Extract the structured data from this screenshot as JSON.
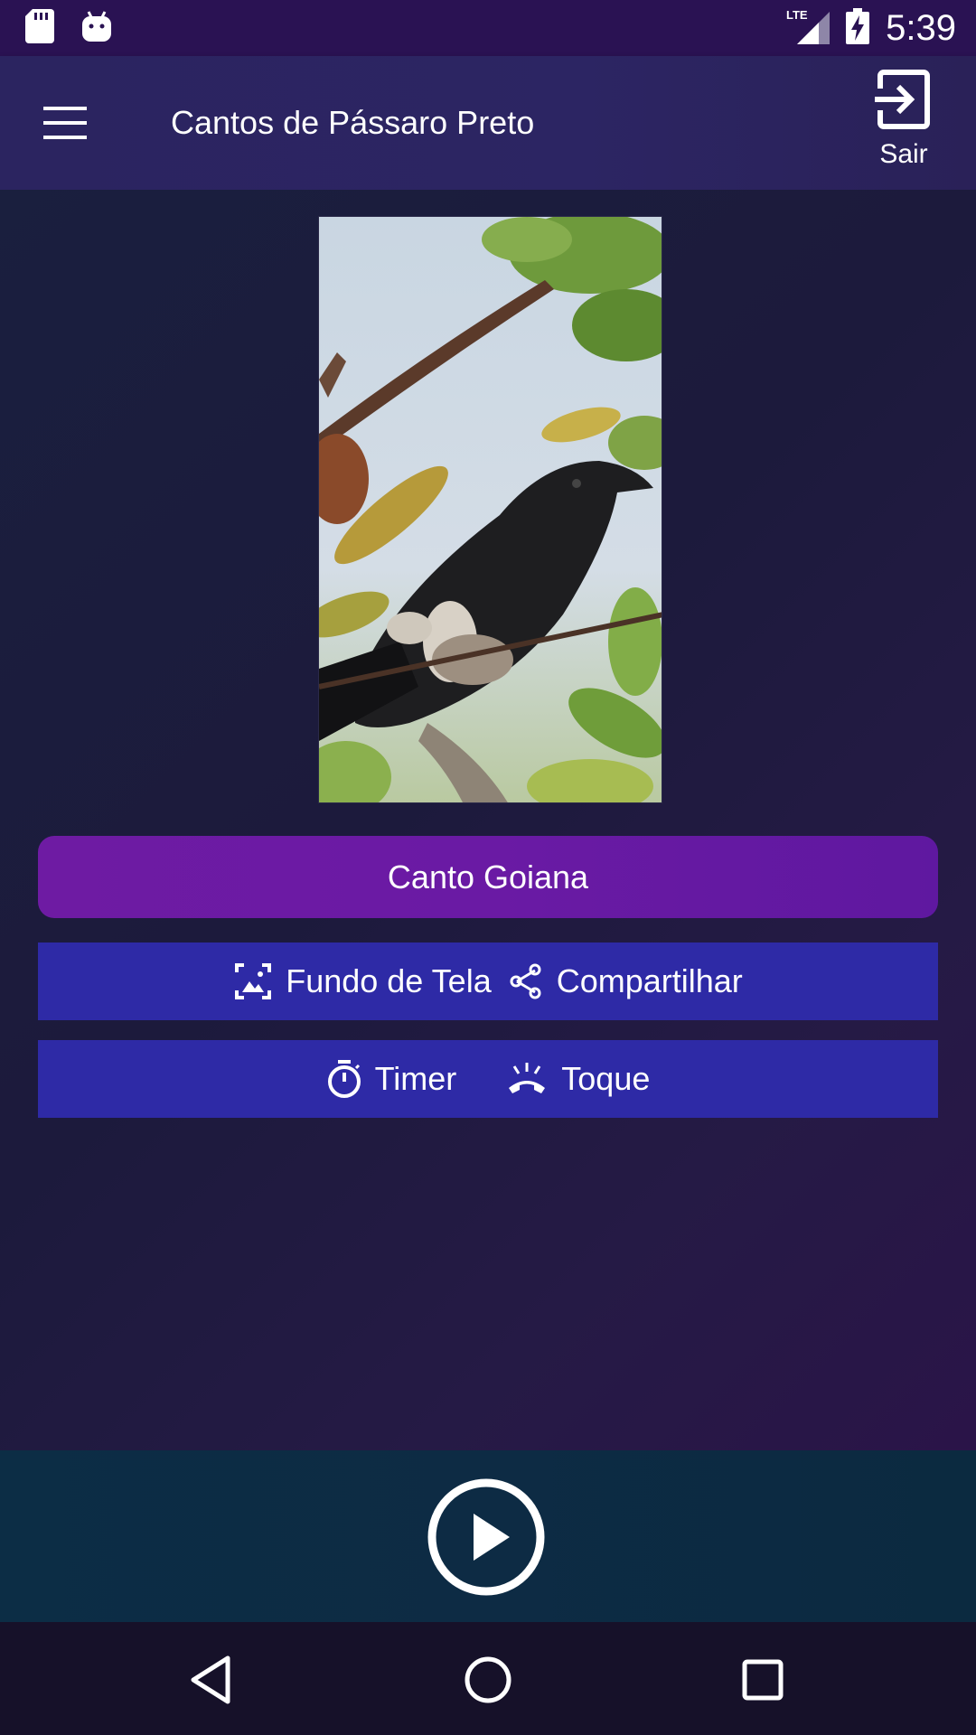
{
  "status_bar": {
    "time": "5:39",
    "network": "LTE",
    "icons": [
      "sd-card-icon",
      "android-icon",
      "lte-signal-icon",
      "battery-charging-icon"
    ]
  },
  "app_bar": {
    "title": "Cantos de Pássaro Preto",
    "exit_label": "Sair",
    "background": "#2b2460"
  },
  "main": {
    "song_button_label": "Canto Goiana",
    "actions_row1": [
      {
        "icon": "wallpaper-icon",
        "label": "Fundo de Tela"
      },
      {
        "icon": "share-icon",
        "label": "Compartilhar"
      }
    ],
    "actions_row2": [
      {
        "icon": "timer-icon",
        "label": "Timer"
      },
      {
        "icon": "ringtone-icon",
        "label": "Toque"
      }
    ],
    "colors": {
      "primary_button": "#6a1aa4",
      "action_button": "#2e2aa6"
    }
  },
  "player": {
    "play_icon": "play-circle-icon",
    "background": "#0c2d45"
  },
  "navigation": {
    "items": [
      "back-icon",
      "home-icon",
      "recents-icon"
    ]
  }
}
